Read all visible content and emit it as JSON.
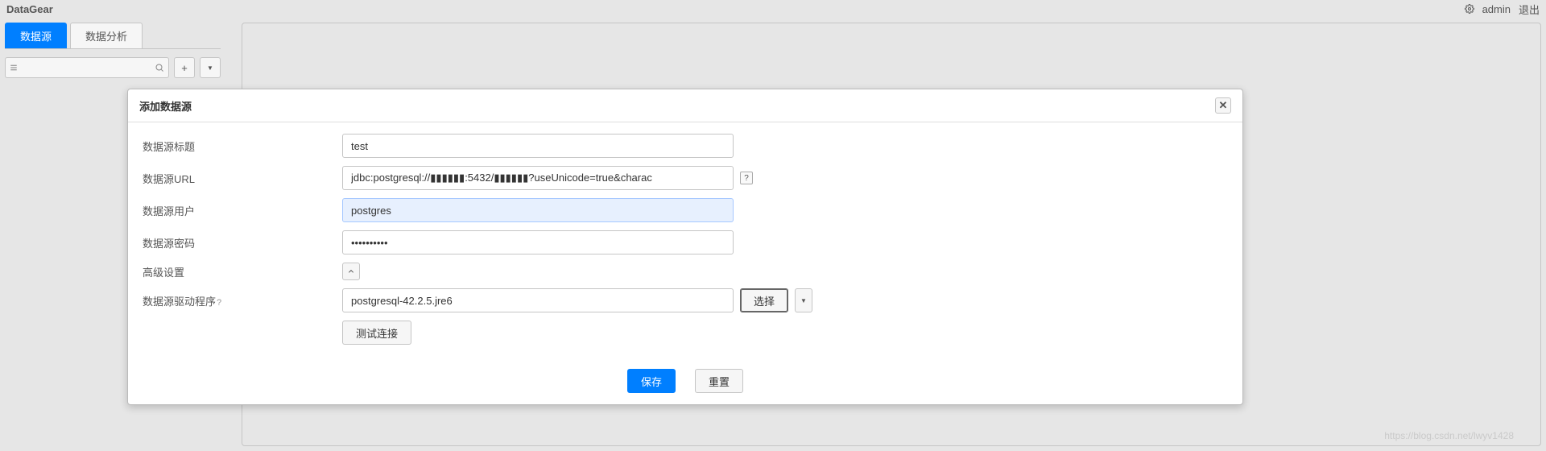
{
  "header": {
    "app_name": "DataGear",
    "username": "admin",
    "logout": "退出"
  },
  "sidebar": {
    "tabs": [
      {
        "label": "数据源",
        "active": true
      },
      {
        "label": "数据分析",
        "active": false
      }
    ],
    "search_placeholder": ""
  },
  "dialog": {
    "title": "添加数据源",
    "fields": {
      "title_label": "数据源标题",
      "title_value": "test",
      "url_label": "数据源URL",
      "url_value": "jdbc:postgresql://▮▮▮▮▮▮:5432/▮▮▮▮▮▮?useUnicode=true&charac",
      "user_label": "数据源用户",
      "user_value": "postgres",
      "password_label": "数据源密码",
      "password_value": "**********",
      "advanced_label": "高级设置",
      "driver_label": "数据源驱动程序",
      "driver_hint": "?",
      "driver_value": "postgresql-42.2.5.jre6",
      "select_label": "选择",
      "test_label": "测试连接"
    },
    "buttons": {
      "save": "保存",
      "reset": "重置"
    }
  },
  "watermark": "https://blog.csdn.net/lwyv1428"
}
